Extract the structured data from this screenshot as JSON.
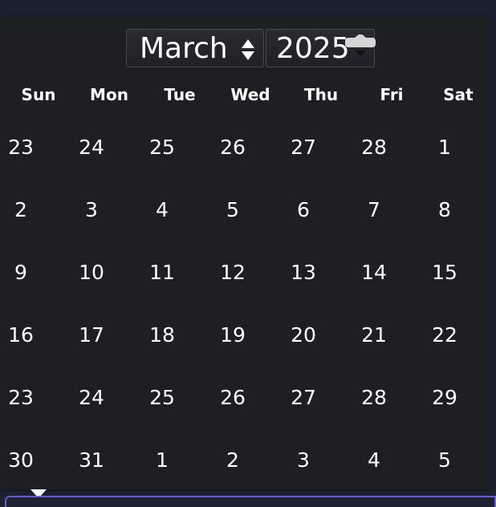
{
  "picker": {
    "month": "March",
    "year": "2025"
  },
  "weekdays": [
    "Sun",
    "Mon",
    "Tue",
    "Wed",
    "Thu",
    "Fri",
    "Sat"
  ],
  "weeks": [
    [
      "23",
      "24",
      "25",
      "26",
      "27",
      "28",
      "1"
    ],
    [
      "2",
      "3",
      "4",
      "5",
      "6",
      "7",
      "8"
    ],
    [
      "9",
      "10",
      "11",
      "12",
      "13",
      "14",
      "15"
    ],
    [
      "16",
      "17",
      "18",
      "19",
      "20",
      "21",
      "22"
    ],
    [
      "23",
      "24",
      "25",
      "26",
      "27",
      "28",
      "29"
    ],
    [
      "30",
      "31",
      "1",
      "2",
      "3",
      "4",
      "5"
    ]
  ],
  "colors": {
    "popup_bg": "#1e1f23",
    "page_bg": "#1c2331",
    "accent_border": "#6b5bd6",
    "text": "#ffffff"
  },
  "icons": {
    "month_select": "updown-arrows-icon",
    "year_select": "stepper-arrows-icon",
    "popup_pointer": "caret-up-icon"
  }
}
